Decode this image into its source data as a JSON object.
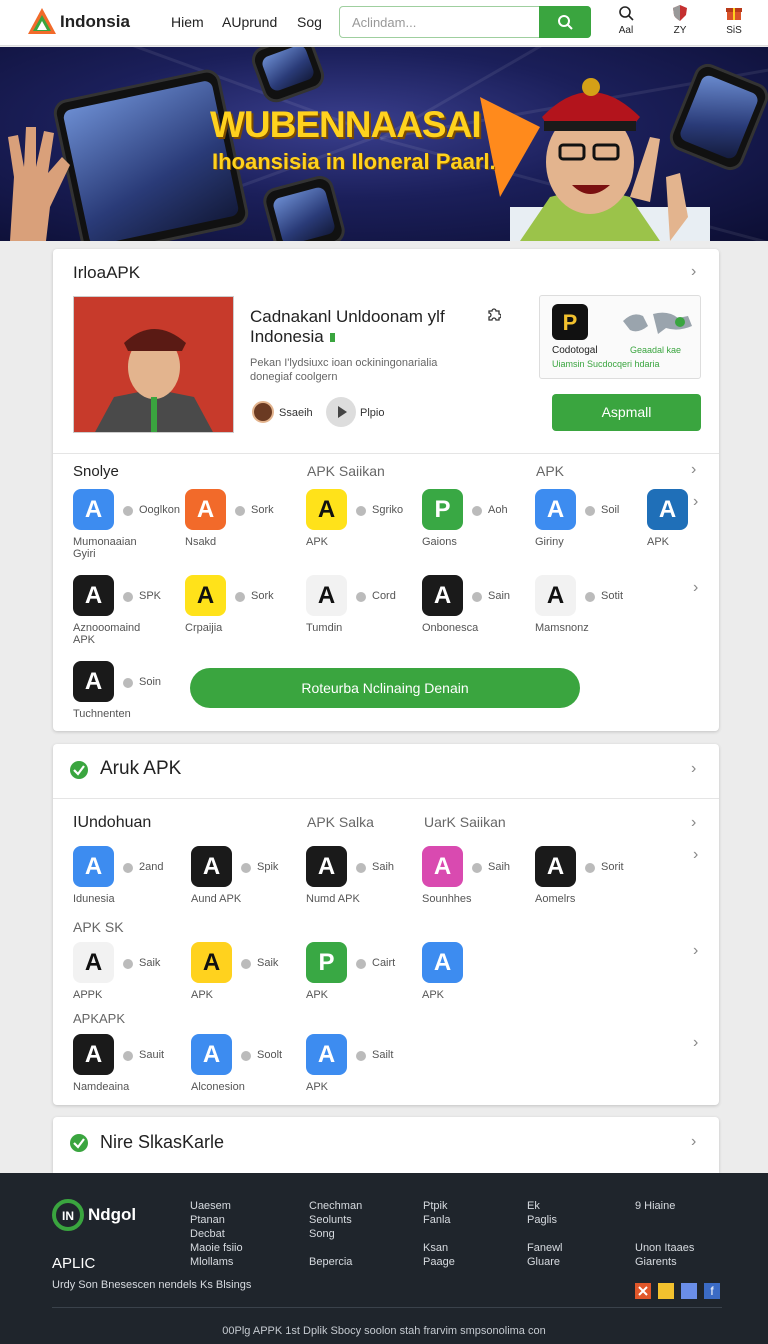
{
  "header": {
    "brand": "Indonsia",
    "nav": [
      "Hiem",
      "AUprund",
      "Sog"
    ],
    "search_placeholder": "Aclindam...",
    "icons": [
      {
        "name": "search-icon",
        "label": "Aal"
      },
      {
        "name": "shield-icon",
        "label": "ZY"
      },
      {
        "name": "gift-icon",
        "label": "SiS"
      }
    ]
  },
  "banner": {
    "title": "WUBENNAASAI",
    "subtitle": "Ihoansisia in Iloneral Paarl."
  },
  "featured": {
    "title": "IrloaAPK",
    "app_name": "Cadnakanl Unldoonam ylf Indonesia",
    "desc_line1": "Pekan I'lydsiuxc ioan ockiningonarialia",
    "desc_line2": "donegiaf coolgern",
    "author1": "Ssaeih",
    "author2": "Plpio",
    "side_title": "Codotogal",
    "side_sub": "Geaadal kae",
    "side_caption": "Uiamsin Sucdocqeri hdaria",
    "install": "Aspmall"
  },
  "section1": {
    "headers": [
      "Snolye",
      "APK Saiikan",
      "APK"
    ],
    "rows": [
      [
        {
          "t": "Ooglkon",
          "l": "Mumonaaian Gyiri",
          "c": "#3d8cf0"
        },
        {
          "t": "Sork",
          "l": "Nsakd",
          "c": "#f26a2a"
        },
        {
          "t": "Sgriko",
          "l": "APK",
          "c": "#ffe21a"
        },
        {
          "t": "Aoh",
          "l": "Gaions",
          "c": "#39a844"
        },
        {
          "t": "Soil",
          "l": "Giriny",
          "c": "#3d8cf0"
        },
        {
          "t": "",
          "l": "APK",
          "c": "#1f6fb8"
        }
      ],
      [
        {
          "t": "SPK",
          "l": "Aznooomaind APK",
          "c": "#1a1a1a"
        },
        {
          "t": "Sork",
          "l": "Crpaijia",
          "c": "#ffe21a"
        },
        {
          "t": "Cord",
          "l": "Tumdin",
          "c": "#f2f2f2"
        },
        {
          "t": "Sain",
          "l": "Onbonesca",
          "c": "#1a1a1a"
        },
        {
          "t": "Sotit",
          "l": "Mamsnonz",
          "c": "#f2f2f2"
        }
      ],
      [
        {
          "t": "Soin",
          "l": "Tuchnenten",
          "c": "#1a1a1a"
        }
      ]
    ],
    "cta": "Roteurba Nclinaing Denain"
  },
  "section2": {
    "title": "Aruk APK",
    "headers": [
      "IUndohuan",
      "APK Salka",
      "UarK Saiikan"
    ],
    "rows": [
      [
        {
          "t": "2and",
          "l": "Idunesia",
          "c": "#3d8cf0"
        },
        {
          "t": "Spik",
          "l": "Aund APK",
          "c": "#1a1a1a"
        },
        {
          "t": "Saih",
          "l": "Numd APK",
          "c": "#1a1a1a"
        },
        {
          "t": "Saih",
          "l": "Sounhhes",
          "c": "#d94ab0"
        },
        {
          "t": "Sorit",
          "l": "Aomelrs",
          "c": "#1a1a1a"
        }
      ],
      [
        {
          "t": "Saik",
          "l": "APPK",
          "c": "#f2f2f2"
        },
        {
          "t": "Saik",
          "l": "APK",
          "c": "#ffd21e"
        },
        {
          "t": "Cairt",
          "l": "APK",
          "c": "#39a844"
        },
        {
          "t": "",
          "l": "APK",
          "c": "#3d8cf0"
        }
      ],
      [
        {
          "t": "Sauit",
          "l": "Namdeaina",
          "c": "#1a1a1a"
        },
        {
          "t": "Soolt",
          "l": "Alconesion",
          "c": "#3d8cf0"
        },
        {
          "t": "Sailt",
          "l": "APK",
          "c": "#3d8cf0"
        }
      ]
    ],
    "sublabels": [
      "APK SK",
      "APKAPK"
    ]
  },
  "section3": {
    "title": "Nire SlkasKarle"
  },
  "footer": {
    "brand": "Ndgol",
    "apk": "APLIC",
    "tagline": "Urdy Son Bnesescen nendels Ks Blsings",
    "col1": [
      "Uaesem",
      "Ptanan",
      "Decbat",
      "Maoie fsiio",
      "Mlollams"
    ],
    "col2": [
      "Cnechman",
      "Seolunts",
      "Song",
      "",
      "Bepercia"
    ],
    "col3": [
      "Ptpik",
      "Fanla",
      "",
      "Ksan",
      "Paage"
    ],
    "col4": [
      "Ek",
      "Paglis",
      "",
      "Fanewl",
      "Gluare"
    ],
    "col5": [
      "9 Hiaine",
      "",
      "",
      "Unon Itaaes",
      "Giarents"
    ],
    "copyright": "00Plg APPK 1st Dplik Sbocy soolon stah frarvim smpsonolima con"
  }
}
